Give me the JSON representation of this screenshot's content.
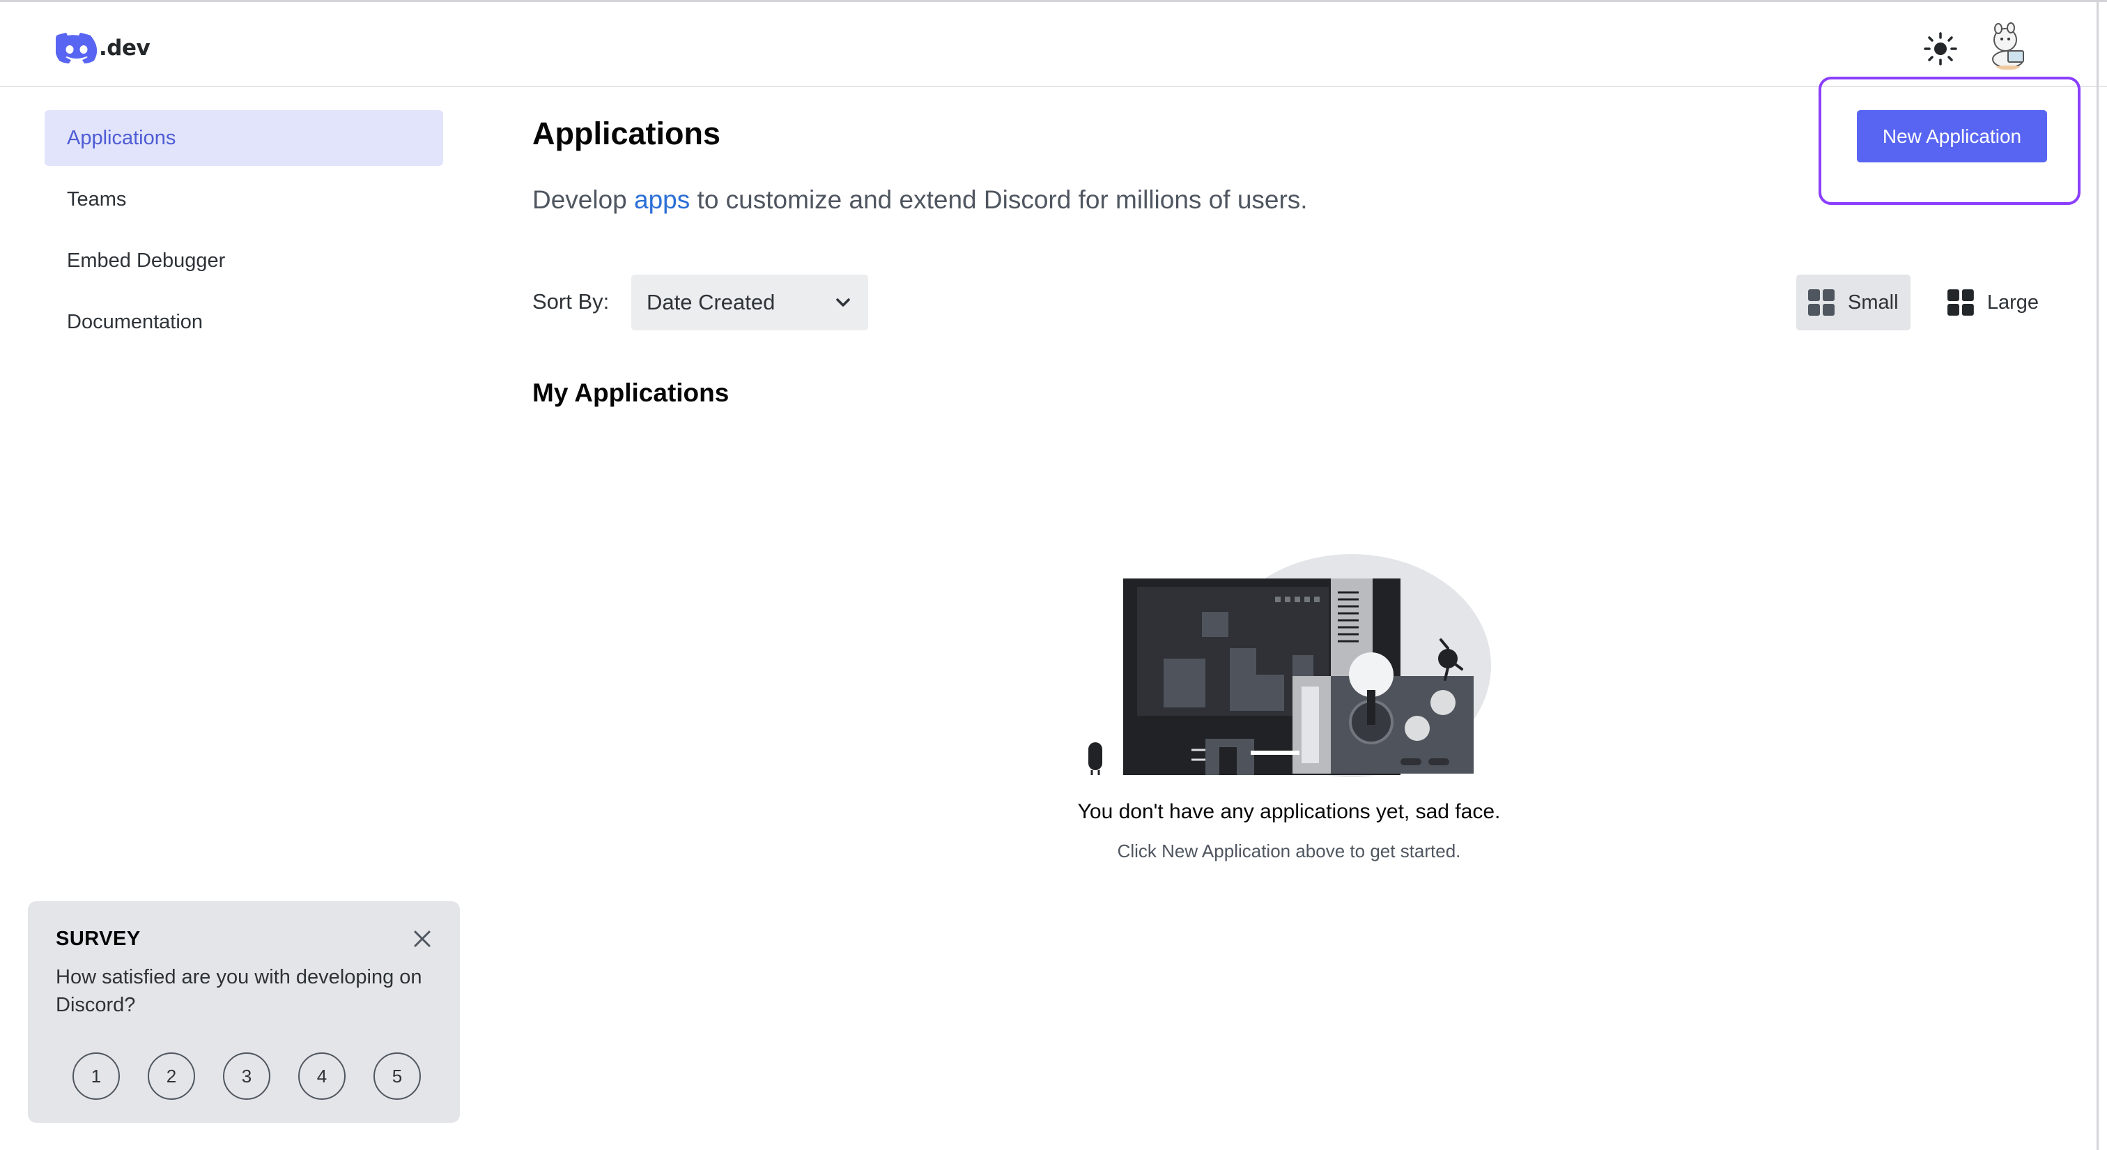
{
  "header": {
    "logo_text": ".dev",
    "brand_color": "#5865f2",
    "theme_icon": "sun-icon",
    "avatar_icon": "user-avatar"
  },
  "sidebar": {
    "items": [
      {
        "label": "Applications",
        "active": true
      },
      {
        "label": "Teams",
        "active": false
      },
      {
        "label": "Embed Debugger",
        "active": false
      },
      {
        "label": "Documentation",
        "active": false
      }
    ]
  },
  "main": {
    "title": "Applications",
    "subtitle_before": "Develop ",
    "subtitle_link": "apps",
    "subtitle_after": " to customize and extend Discord for millions of users.",
    "new_app_button": "New Application",
    "sort_label": "Sort By:",
    "sort_value": "Date Created",
    "view_small": "Small",
    "view_large": "Large",
    "section_title": "My Applications",
    "empty_title": "You don't have any applications yet, sad face.",
    "empty_subtitle": "Click New Application above to get started."
  },
  "survey": {
    "title": "SURVEY",
    "question": "How satisfied are you with developing on Discord?",
    "options": [
      "1",
      "2",
      "3",
      "4",
      "5"
    ]
  },
  "colors": {
    "accent": "#5865f2",
    "highlight_outline": "#8b3ffc",
    "link": "#2b6fd6",
    "active_nav_bg": "#e2e4fb"
  }
}
